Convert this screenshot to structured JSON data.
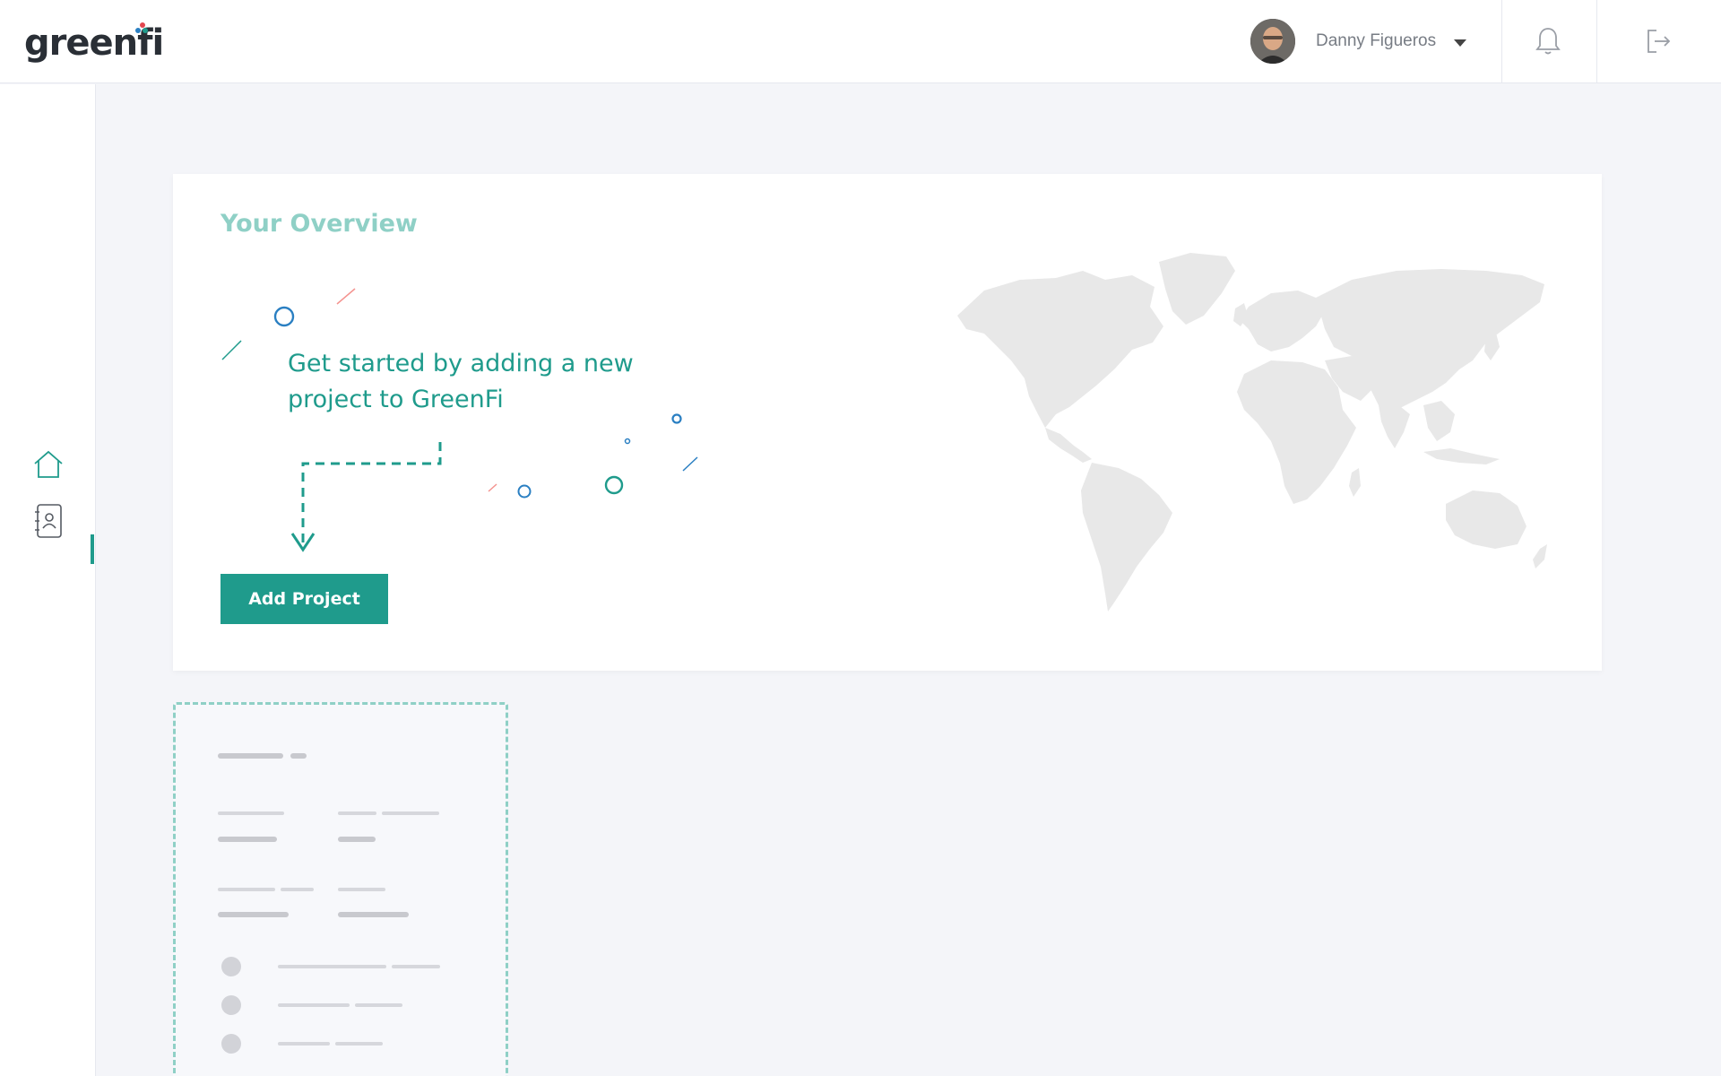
{
  "header": {
    "logo_text": "greenfi",
    "user_name": "Danny Figueros"
  },
  "overview": {
    "title": "Your Overview",
    "headline": "Get started by adding a new project to GreenFi",
    "add_button_label": "Add Project"
  },
  "colors": {
    "accent": "#1f9b8c",
    "accent_light": "#8fd0c6",
    "background": "#f4f5f9",
    "map": "#e8e8e8"
  },
  "icons": {
    "home": "home-icon",
    "contacts": "contacts-icon",
    "notifications": "bell-icon",
    "logout": "logout-icon",
    "user_menu": "caret-down-icon"
  }
}
